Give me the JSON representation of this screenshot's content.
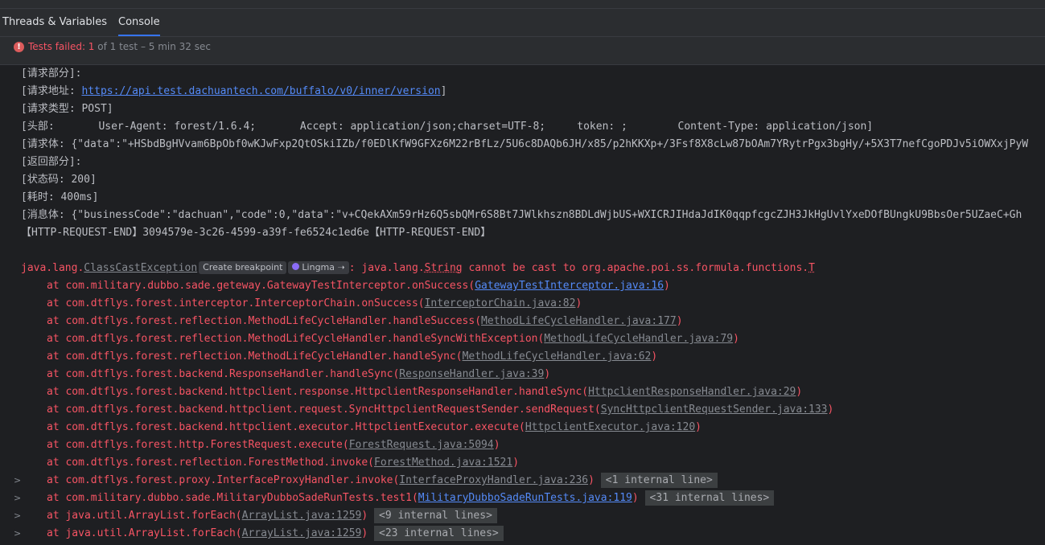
{
  "tabs": [
    {
      "label": "Threads & Variables",
      "active": false
    },
    {
      "label": "Console",
      "active": true
    }
  ],
  "status": {
    "icon": "error-icon",
    "failed_label": "Tests failed: 1",
    "detail": " of 1 test – 5 min 32 sec"
  },
  "colors": {
    "accent": "#3574f0",
    "error": "#f75464",
    "link": "#548af7"
  },
  "log": {
    "req_part": "[请求部分]:",
    "req_addr_prefix": "[请求地址: ",
    "req_addr_url": "https://api.test.dachuantech.com/buffalo/v0/inner/version",
    "req_addr_suffix": "]",
    "req_type": "[请求类型: POST]",
    "headers": "[头部:       User-Agent: forest/1.6.4;       Accept: application/json;charset=UTF-8;     token: ;        Content-Type: application/json]",
    "req_body": "[请求体: {\"data\":\"+HSbdBgHVvam6BpObf0wKJwFxp2QtOSkiIZb/f0EDlKfW9GFXz6M22rBfLz/5U6c8DAQb6JH/x85/p2hKKXp+/3Fsf8X8cLw87bOAm7YRytrPgx3bgHy/+5X3T7nefCgoPDJv5iOWXxjPyW",
    "resp_part": "[返回部分]:",
    "status_code": "[状态码: 200]",
    "elapsed": "[耗时: 400ms]",
    "msg_body": "[消息体: {\"businessCode\":\"dachuan\",\"code\":0,\"data\":\"v+CQekAXm59rHz6Q5sbQMr6S8Bt7JWlkhszn8BDLdWjbUS+WXICRJIHdaJdIK0qqpfcgcZJH3JkHgUvlYxeDOfBUngkU9BbsOer5UZaeC+Gh",
    "end_marker": "【HTTP-REQUEST-END】3094579e-3c26-4599-a39f-fe6524c1ed6e【HTTP-REQUEST-END】"
  },
  "exception": {
    "pkg": "java.lang.",
    "cls": "ClassCastException",
    "create_breakpoint": "Create breakpoint",
    "lingma": "Lingma ➝",
    "sep": ": java.lang.",
    "string_word": "String",
    "rest": " cannot be cast to org.apache.poi.ss.formula.functions.",
    "tail": "T"
  },
  "stack": [
    {
      "method": "at com.military.dubbo.sade.geteway.GatewayTestInterceptor.onSuccess(",
      "src": "GatewayTestInterceptor.java:16",
      "close": ")",
      "link": true,
      "expand": false,
      "internal": ""
    },
    {
      "method": "at com.dtflys.forest.interceptor.InterceptorChain.onSuccess(",
      "src": "InterceptorChain.java:82",
      "close": ")",
      "link": false,
      "expand": false,
      "internal": ""
    },
    {
      "method": "at com.dtflys.forest.reflection.MethodLifeCycleHandler.handleSuccess(",
      "src": "MethodLifeCycleHandler.java:177",
      "close": ")",
      "link": false,
      "expand": false,
      "internal": ""
    },
    {
      "method": "at com.dtflys.forest.reflection.MethodLifeCycleHandler.handleSyncWithException(",
      "src": "MethodLifeCycleHandler.java:79",
      "close": ")",
      "link": false,
      "expand": false,
      "internal": ""
    },
    {
      "method": "at com.dtflys.forest.reflection.MethodLifeCycleHandler.handleSync(",
      "src": "MethodLifeCycleHandler.java:62",
      "close": ")",
      "link": false,
      "expand": false,
      "internal": ""
    },
    {
      "method": "at com.dtflys.forest.backend.ResponseHandler.handleSync(",
      "src": "ResponseHandler.java:39",
      "close": ")",
      "link": false,
      "expand": false,
      "internal": ""
    },
    {
      "method": "at com.dtflys.forest.backend.httpclient.response.HttpclientResponseHandler.handleSync(",
      "src": "HttpclientResponseHandler.java:29",
      "close": ")",
      "link": false,
      "expand": false,
      "internal": ""
    },
    {
      "method": "at com.dtflys.forest.backend.httpclient.request.SyncHttpclientRequestSender.sendRequest(",
      "src": "SyncHttpclientRequestSender.java:133",
      "close": ")",
      "link": false,
      "expand": false,
      "internal": ""
    },
    {
      "method": "at com.dtflys.forest.backend.httpclient.executor.HttpclientExecutor.execute(",
      "src": "HttpclientExecutor.java:120",
      "close": ")",
      "link": false,
      "expand": false,
      "internal": ""
    },
    {
      "method": "at com.dtflys.forest.http.ForestRequest.execute(",
      "src": "ForestRequest.java:5094",
      "close": ")",
      "link": false,
      "expand": false,
      "internal": ""
    },
    {
      "method": "at com.dtflys.forest.reflection.ForestMethod.invoke(",
      "src": "ForestMethod.java:1521",
      "close": ")",
      "link": false,
      "expand": false,
      "internal": ""
    },
    {
      "method": "at com.dtflys.forest.proxy.InterfaceProxyHandler.invoke(",
      "src": "InterfaceProxyHandler.java:236",
      "close": ")",
      "link": false,
      "expand": true,
      "internal": "<1 internal line>"
    },
    {
      "method": "at com.military.dubbo.sade.MilitaryDubboSadeRunTests.test1(",
      "src": "MilitaryDubboSadeRunTests.java:119",
      "close": ")",
      "link": true,
      "expand": true,
      "internal": "<31 internal lines>"
    },
    {
      "method": "at java.util.ArrayList.forEach(",
      "src": "ArrayList.java:1259",
      "close": ")",
      "link": false,
      "expand": true,
      "internal": "<9 internal lines>"
    },
    {
      "method": "at java.util.ArrayList.forEach(",
      "src": "ArrayList.java:1259",
      "close": ")",
      "link": false,
      "expand": true,
      "internal": "<23 internal lines>"
    }
  ]
}
